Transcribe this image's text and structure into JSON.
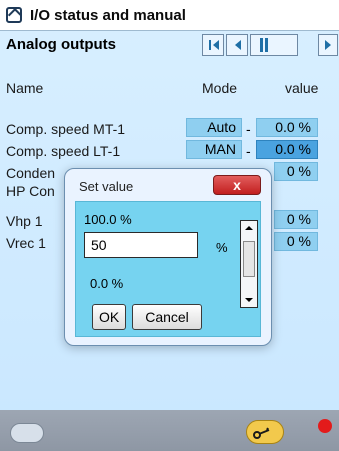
{
  "title": {
    "text": "I/O status and manual"
  },
  "section": {
    "text": "Analog outputs"
  },
  "table": {
    "headers": {
      "name": "Name",
      "mode": "Mode",
      "value": "value"
    },
    "rows": [
      {
        "name": "Comp. speed MT-1",
        "mode": "Auto",
        "sep": "-",
        "value": "0.0 %",
        "selected": false
      },
      {
        "name": "Comp. speed LT-1",
        "mode": "MAN",
        "sep": "-",
        "value": "0.0 %",
        "selected": true
      },
      {
        "name": "Conden",
        "mode": "",
        "sep": "",
        "value": "0 %",
        "selected": false
      },
      {
        "name": "HP Con",
        "mode": "",
        "sep": "",
        "value": "",
        "selected": false
      },
      {
        "name": "Vhp 1",
        "mode": "",
        "sep": "",
        "value": "0 %",
        "selected": false
      },
      {
        "name": "Vrec 1",
        "mode": "",
        "sep": "",
        "value": "0 %",
        "selected": false
      }
    ]
  },
  "dialog": {
    "title": "Set value",
    "close": "x",
    "max": "100.0 %",
    "input_value": "50",
    "unit": "%",
    "min": "0.0 %",
    "ok": "OK",
    "cancel": "Cancel"
  },
  "icons": {
    "home": "home-icon",
    "camera": "camera-icon",
    "key": "key-icon",
    "alarm": "alarm-bell-icon"
  }
}
